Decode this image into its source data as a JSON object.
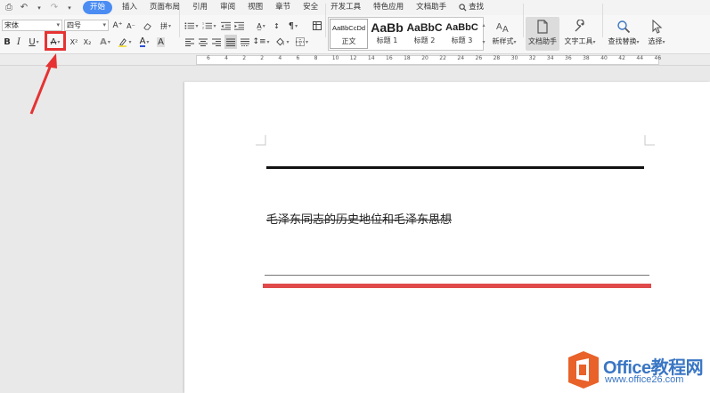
{
  "menubar": {
    "tabs": [
      {
        "label": "开始",
        "active": true
      },
      {
        "label": "插入"
      },
      {
        "label": "页面布局"
      },
      {
        "label": "引用"
      },
      {
        "label": "审阅"
      },
      {
        "label": "视图"
      },
      {
        "label": "章节"
      },
      {
        "label": "安全"
      },
      {
        "label": "开发工具"
      },
      {
        "label": "特色应用"
      },
      {
        "label": "文档助手"
      }
    ],
    "search_label": "查找"
  },
  "ribbon": {
    "font_name": "宋体",
    "font_size": "四号",
    "bold": "B",
    "italic": "I",
    "underline": "U",
    "strikethrough": "A",
    "superscript": "X²",
    "subscript": "X₂",
    "grow_font": "A⁺",
    "shrink_font": "A⁻",
    "font_color": "A",
    "styles": [
      {
        "sample": "AaBbCcDd",
        "label": "正文"
      },
      {
        "sample": "AaBb",
        "label": "标题 1"
      },
      {
        "sample": "AaBbC",
        "label": "标题 2"
      },
      {
        "sample": "AaBbC",
        "label": "标题 3"
      }
    ],
    "new_style": "新样式",
    "doc_assistant": "文档助手",
    "text_tools": "文字工具",
    "find_replace": "查找替换",
    "select": "选择"
  },
  "ruler": {
    "ticks": [
      "6",
      "4",
      "2",
      "2",
      "4",
      "6",
      "8",
      "10",
      "12",
      "14",
      "16",
      "18",
      "20",
      "22",
      "24",
      "26",
      "28",
      "30",
      "32",
      "34",
      "36",
      "38",
      "40",
      "42",
      "44",
      "46"
    ]
  },
  "document": {
    "text": "毛泽东同志的历史地位和毛泽东思想"
  },
  "watermark": {
    "title": "Office教程网",
    "url": "www.office26.com"
  },
  "colors": {
    "accent": "#4b8cf3",
    "annotation": "#e63232",
    "red_rule": "#e04a4a",
    "watermark": "#3a76c4",
    "watermark_icon": "#e8622a"
  }
}
